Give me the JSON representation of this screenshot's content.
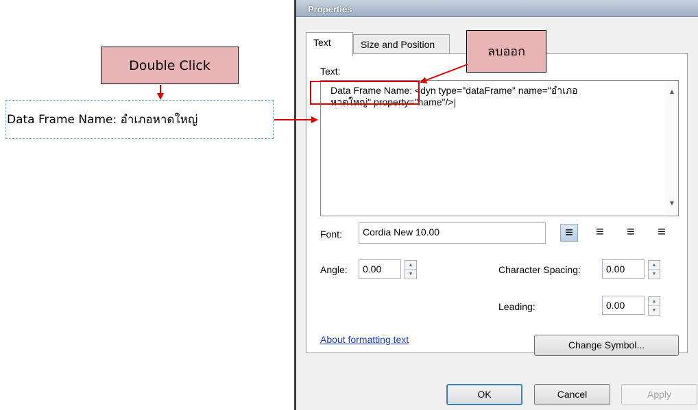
{
  "annotations": {
    "double_click": "Double Click",
    "delete_note": "ลบออก",
    "highlight_color": "#e00000",
    "callout_color": "#e8b4b6"
  },
  "canvas_text": "Data Frame Name: อำเภอหาดใหญ่",
  "window": {
    "title": "Properties",
    "tabs": [
      {
        "label": "Text",
        "active": true
      },
      {
        "label": "Size and Position",
        "active": false
      }
    ],
    "text_label": "Text:",
    "text_value": "Data Frame Name: <dyn type=\"dataFrame\" name=\"อำเภอ\nหาดใหญ่\" property=\"name\"/>|",
    "font_label": "Font:",
    "font_value": "Cordia New 10.00",
    "angle_label": "Angle:",
    "angle_value": "0.00",
    "char_spacing_label": "Character Spacing:",
    "char_spacing_value": "0.00",
    "leading_label": "Leading:",
    "leading_value": "0.00",
    "about_link": "About formatting text",
    "change_symbol": "Change Symbol...",
    "ok": "OK",
    "cancel": "Cancel",
    "apply": "Apply",
    "alignment": [
      "align-left",
      "align-center",
      "align-right",
      "align-justify"
    ],
    "selected_alignment": "align-left"
  }
}
